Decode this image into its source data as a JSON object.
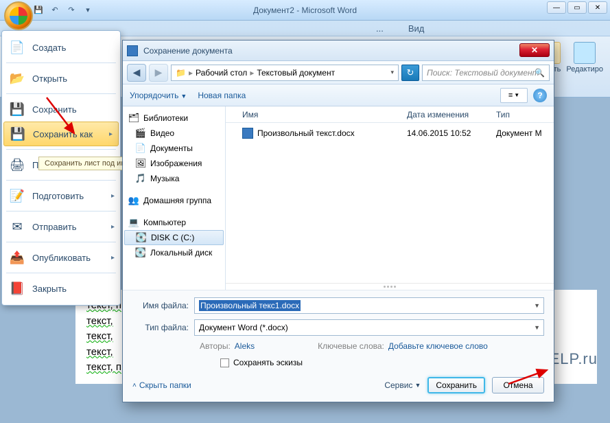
{
  "title": "Документ2 - Microsoft Word",
  "ribbon_tabs": {
    "tab1": "...",
    "tab2": "Вид"
  },
  "ribbon_right": {
    "btn1": "...нить",
    "btn2": "Редактиро"
  },
  "office_menu": {
    "new": "Создать",
    "open": "Открыть",
    "save": "Сохранить",
    "save_as": "Сохранить как",
    "print": "Печать",
    "prepare": "Подготовить",
    "send": "Отправить",
    "publish": "Опубликовать",
    "close": "Закрыть",
    "tooltip": "Сохранить лист под им..."
  },
  "dialog": {
    "title": "Сохранение документа",
    "breadcrumb": {
      "p1": "Рабочий стол",
      "p2": "Текстовый документ"
    },
    "search_placeholder": "Поиск: Текстовый документ",
    "toolbar": {
      "organize": "Упорядочить",
      "new_folder": "Новая папка"
    },
    "tree": {
      "libraries": "Библиотеки",
      "video": "Видео",
      "documents": "Документы",
      "pictures": "Изображения",
      "music": "Музыка",
      "homegroup": "Домашняя группа",
      "computer": "Компьютер",
      "disk_c": "DISK C (C:)",
      "local_disk": "Локальный диск"
    },
    "columns": {
      "name": "Имя",
      "date": "Дата изменения",
      "type": "Тип"
    },
    "file": {
      "name": "Произвольный текст.docx",
      "date": "14.06.2015 10:52",
      "type": "Документ M"
    },
    "labels": {
      "filename": "Имя файла:",
      "filetype": "Тип файла:",
      "authors": "Авторы:",
      "keywords": "Ключевые слова:",
      "save_thumb": "Сохранять эскизы",
      "hide_folders": "Скрыть папки",
      "tools": "Сервис"
    },
    "values": {
      "filename": "Произвольный текс1.docx",
      "filetype": "Документ Word (*.docx)",
      "author": "Aleks",
      "keywords_hint": "Добавьте ключевое слово"
    },
    "buttons": {
      "save": "Сохранить",
      "cancel": "Отмена"
    }
  },
  "page_text": {
    "l1": "текст, произвольный текст, произвольный текст, произвольный текст, произвольный",
    "l2": "текст,",
    "l3": "текст,",
    "l4": "текст,",
    "l5": "текст, произвольный текст, произвольный текст, произвольный текст, произвольный"
  },
  "watermark": "LiWiHELP.ru"
}
